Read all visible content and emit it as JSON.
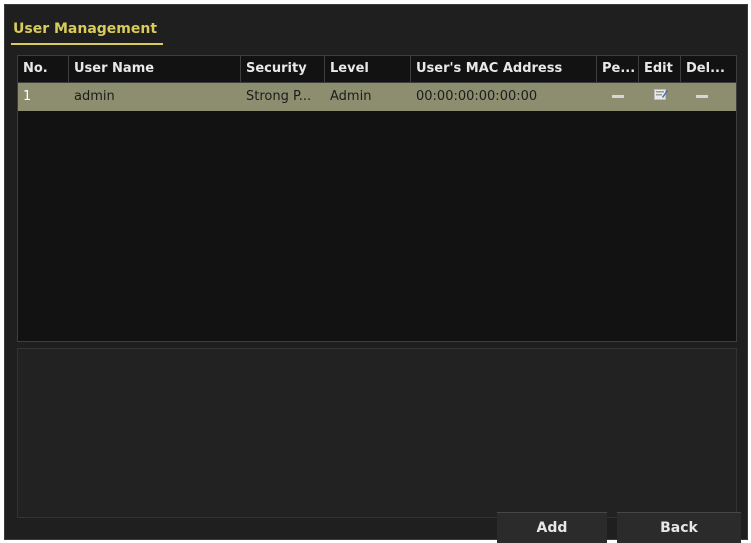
{
  "tab_label": "User Management",
  "columns": {
    "no": "No.",
    "user_name": "User Name",
    "security": "Security",
    "level": "Level",
    "mac": "User's MAC Address",
    "permission": "Pe...",
    "edit": "Edit",
    "delete": "Del..."
  },
  "rows": [
    {
      "no": "1",
      "user_name": "admin",
      "security": "Strong P...",
      "level": "Admin",
      "mac": "00:00:00:00:00:00",
      "permission_icon": "dash-icon",
      "edit_icon": "edit-icon",
      "delete_icon": "dash-icon"
    }
  ],
  "buttons": {
    "add": "Add",
    "back": "Back"
  },
  "colors": {
    "accent": "#d8cc5a",
    "selected_row": "#8d8d6f"
  }
}
